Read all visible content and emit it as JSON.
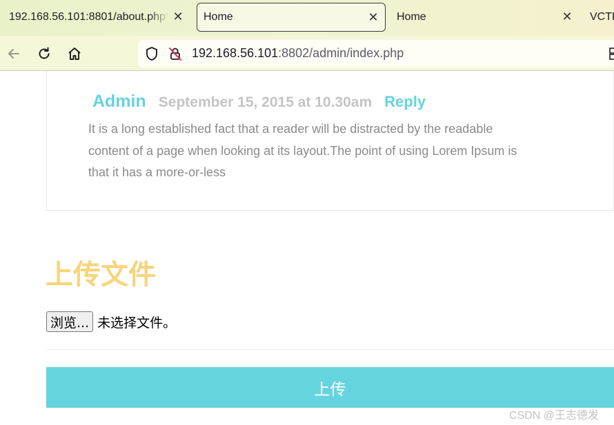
{
  "browser": {
    "tabs": [
      {
        "label": "192.168.56.101:8801/about.php?"
      },
      {
        "label": "Home"
      },
      {
        "label": "Home"
      },
      {
        "label": "VCTF"
      }
    ],
    "url_host": "192.168.56.101",
    "url_rest": ":8802/admin/index.php",
    "icons": [
      "back-icon",
      "reload-icon",
      "home-icon",
      "shield-icon",
      "insecure-lock-icon",
      "close-icon"
    ]
  },
  "comment": {
    "author": "Admin",
    "date": "September 15, 2015 at 10.30am",
    "reply": "Reply",
    "body": "It is a long established fact that a reader will be distracted by the readable content of a page when looking at its layout.The point of using Lorem Ipsum is that it has a more-or-less"
  },
  "upload": {
    "title": "上传文件",
    "browse_label": "浏览...",
    "file_status": "未选择文件。",
    "submit_label": "上传"
  },
  "watermark": "CSDN @王志德发",
  "colors": {
    "accent": "#66d4de",
    "title": "#f7d57c",
    "muted_text": "#8a8a8a"
  }
}
